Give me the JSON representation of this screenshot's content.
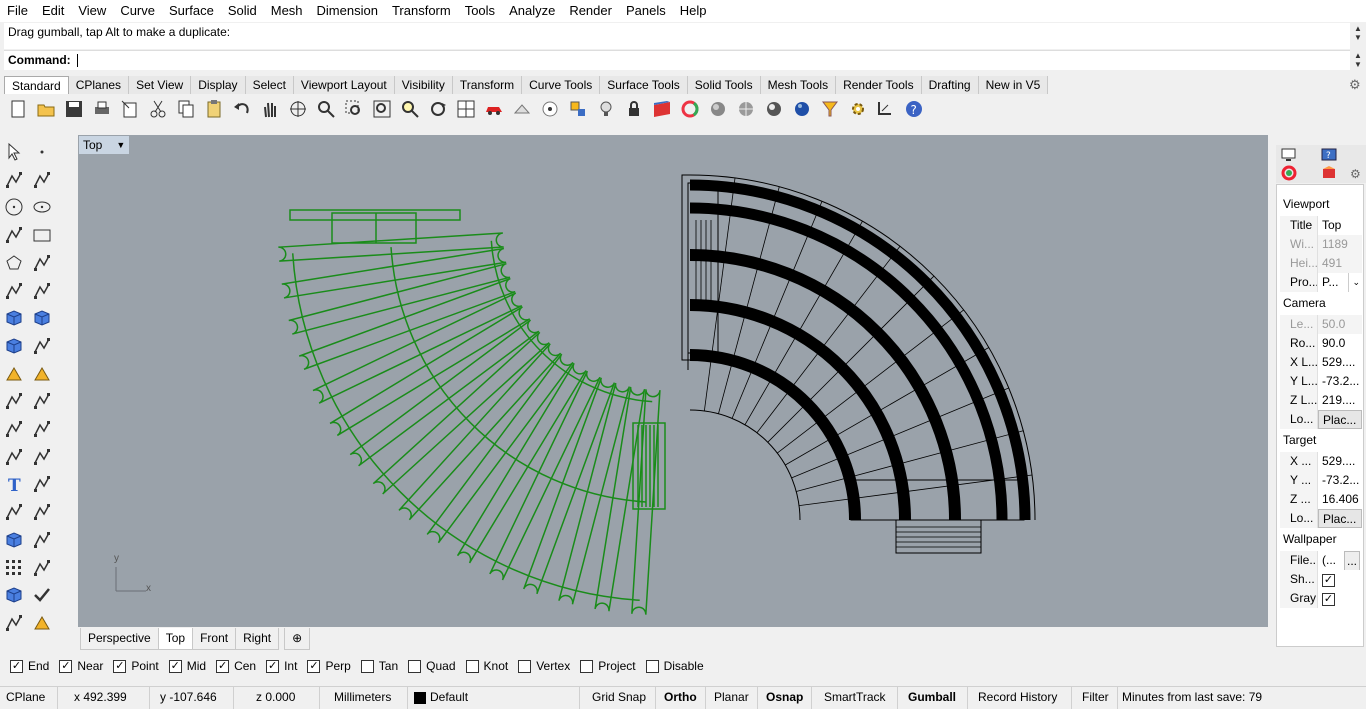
{
  "menu": [
    "File",
    "Edit",
    "View",
    "Curve",
    "Surface",
    "Solid",
    "Mesh",
    "Dimension",
    "Transform",
    "Tools",
    "Analyze",
    "Render",
    "Panels",
    "Help"
  ],
  "command": {
    "history": "Drag gumball, tap Alt to make a duplicate:",
    "prompt_label": "Command:",
    "input_value": ""
  },
  "toolbar_tabs": [
    "Standard",
    "CPlanes",
    "Set View",
    "Display",
    "Select",
    "Viewport Layout",
    "Visibility",
    "Transform",
    "Curve Tools",
    "Surface Tools",
    "Solid Tools",
    "Mesh Tools",
    "Render Tools",
    "Drafting",
    "New in V5"
  ],
  "toolbar_icons": [
    "new-icon",
    "open-icon",
    "save-icon",
    "print-icon",
    "import-icon",
    "cut-icon",
    "copy-icon",
    "paste-icon",
    "undo-icon",
    "pan-hand-icon",
    "rotate-view-icon",
    "zoom-icon",
    "zoom-window-icon",
    "zoom-extents-icon",
    "zoom-selected-icon",
    "rotate-icon",
    "four-viewports-icon",
    "car-icon",
    "options-icon",
    "point-icon",
    "snap-icon",
    "light-icon",
    "lock-icon",
    "layer-icon",
    "color-wheel-icon",
    "render-sphere-icon",
    "shaded-sphere-icon",
    "rendered-sphere-icon",
    "blue-sphere-icon",
    "filter-icon",
    "settings-gear-icon",
    "dimension-icon",
    "help-icon"
  ],
  "viewport": {
    "title": "Top",
    "axis_y": "y",
    "axis_x": "x",
    "colors": {
      "background": "#9aa2aa",
      "selected": "#1a8c1a",
      "object": "#000000"
    }
  },
  "viewport_tabs": [
    "Perspective",
    "Top",
    "Front",
    "Right"
  ],
  "active_viewport_tab": "Top",
  "osnaps": [
    {
      "label": "End",
      "checked": true
    },
    {
      "label": "Near",
      "checked": true
    },
    {
      "label": "Point",
      "checked": true
    },
    {
      "label": "Mid",
      "checked": true
    },
    {
      "label": "Cen",
      "checked": true
    },
    {
      "label": "Int",
      "checked": true
    },
    {
      "label": "Perp",
      "checked": true
    },
    {
      "label": "Tan",
      "checked": false
    },
    {
      "label": "Quad",
      "checked": false
    },
    {
      "label": "Knot",
      "checked": false
    },
    {
      "label": "Vertex",
      "checked": false
    },
    {
      "label": "Project",
      "checked": false
    },
    {
      "label": "Disable",
      "checked": false
    }
  ],
  "status": {
    "cplane": "CPlane",
    "x": "x 492.399",
    "y": "y -107.646",
    "z": "z 0.000",
    "units": "Millimeters",
    "layer": "Default",
    "grid_snap": "Grid Snap",
    "ortho": "Ortho",
    "planar": "Planar",
    "osnap": "Osnap",
    "smarttrack": "SmartTrack",
    "gumball": "Gumball",
    "record_history": "Record History",
    "filter": "Filter",
    "minutes": "Minutes from last save: 79"
  },
  "properties": {
    "viewport_header": "Viewport",
    "title_k": "Title",
    "title_v": "Top",
    "width_k": "Wi...",
    "width_v": "1189",
    "height_k": "Hei...",
    "height_v": "491",
    "proj_k": "Pro...",
    "proj_v": "P...",
    "camera_header": "Camera",
    "lens_k": "Le...",
    "lens_v": "50.0",
    "rot_k": "Ro...",
    "rot_v": "90.0",
    "cx_k": "X L...",
    "cx_v": "529....",
    "cy_k": "Y L...",
    "cy_v": "-73.2...",
    "cz_k": "Z L...",
    "cz_v": "219....",
    "cloc_k": "Lo...",
    "cloc_v": "Plac...",
    "target_header": "Target",
    "tx_k": "X ...",
    "tx_v": "529....",
    "ty_k": "Y ...",
    "ty_v": "-73.2...",
    "tz_k": "Z ...",
    "tz_v": "16.406",
    "tloc_k": "Lo...",
    "tloc_v": "Plac...",
    "wallpaper_header": "Wallpaper",
    "file_k": "File...",
    "file_v": "(...",
    "show_k": "Sh...",
    "gray_k": "Gray"
  }
}
